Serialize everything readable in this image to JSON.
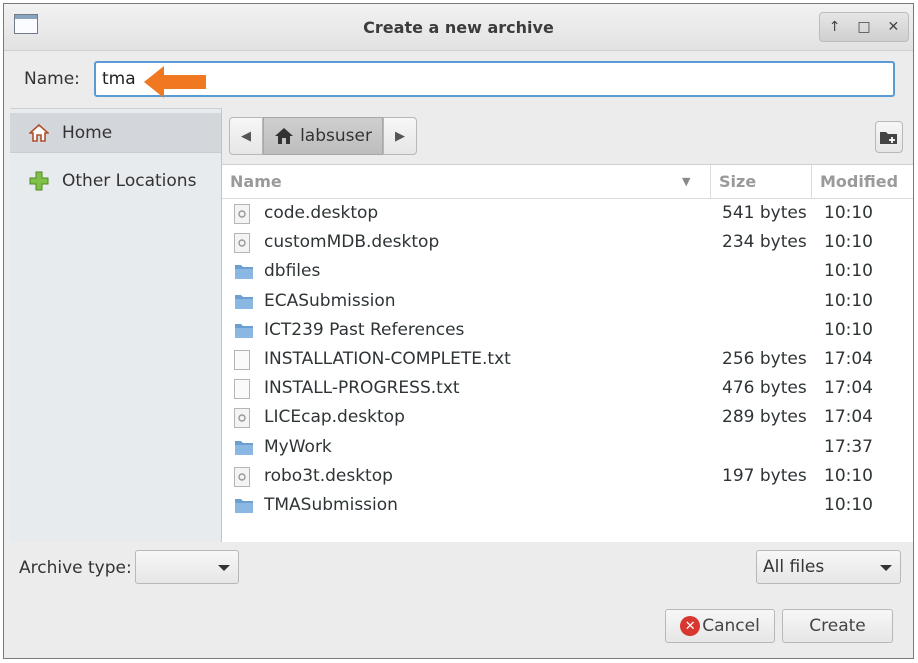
{
  "window": {
    "title": "Create a new archive",
    "controls": [
      "↑",
      "□",
      "✕"
    ]
  },
  "name_field": {
    "label": "Name:",
    "value": "tma"
  },
  "sidebar": {
    "items": [
      {
        "label": "Home",
        "icon": "home-icon"
      },
      {
        "label": "Other Locations",
        "icon": "plus-icon"
      }
    ]
  },
  "pathbar": {
    "current": "labsuser"
  },
  "columns": {
    "name": "Name",
    "size": "Size",
    "modified": "Modified"
  },
  "files": [
    {
      "name": "code.desktop",
      "size": "541 bytes",
      "modified": "10:10",
      "type": "desktop"
    },
    {
      "name": "customMDB.desktop",
      "size": "234 bytes",
      "modified": "10:10",
      "type": "desktop"
    },
    {
      "name": "dbfiles",
      "size": "",
      "modified": "10:10",
      "type": "folder"
    },
    {
      "name": "ECASubmission",
      "size": "",
      "modified": "10:10",
      "type": "folder"
    },
    {
      "name": "ICT239 Past References",
      "size": "",
      "modified": "10:10",
      "type": "folder"
    },
    {
      "name": "INSTALLATION-COMPLETE.txt",
      "size": "256 bytes",
      "modified": "17:04",
      "type": "text"
    },
    {
      "name": "INSTALL-PROGRESS.txt",
      "size": "476 bytes",
      "modified": "17:04",
      "type": "text"
    },
    {
      "name": "LICEcap.desktop",
      "size": "289 bytes",
      "modified": "17:04",
      "type": "desktop"
    },
    {
      "name": "MyWork",
      "size": "",
      "modified": "17:37",
      "type": "folder"
    },
    {
      "name": "robo3t.desktop",
      "size": "197 bytes",
      "modified": "10:10",
      "type": "desktop"
    },
    {
      "name": "TMASubmission",
      "size": "",
      "modified": "10:10",
      "type": "folder"
    }
  ],
  "archive_type": {
    "label": "Archive type:",
    "value": ""
  },
  "filter": {
    "value": "All files"
  },
  "buttons": {
    "cancel": "Cancel",
    "create": "Create"
  },
  "colors": {
    "accent": "#5b9bd5",
    "arrow": "#f07820",
    "folder": "#6a9fd0"
  }
}
